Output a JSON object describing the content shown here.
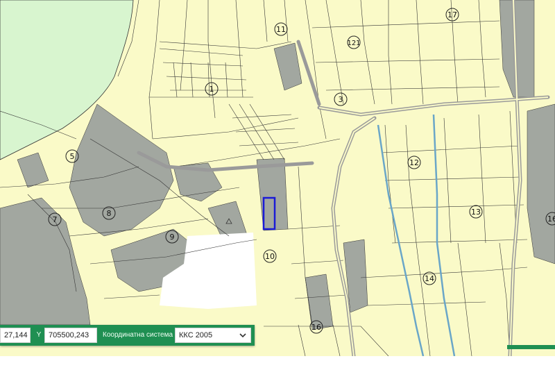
{
  "toolbar": {
    "x_value": "27,144",
    "y_label": "Y",
    "y_value": "705500,243",
    "crs_label": "Координатна система",
    "crs_value": "ККС 2005"
  },
  "map": {
    "colors": {
      "parcel": "#fafac8",
      "forest": "#d8f5cf",
      "built": "#9ea49c",
      "road": "#a9a9a9",
      "line": "#333333",
      "selected": "#1a1ad6"
    },
    "district_labels": [
      "11",
      "17",
      "121",
      "1",
      "3",
      "5",
      "12",
      "8",
      "7",
      "9",
      "13",
      "10",
      "14",
      "16",
      "16"
    ]
  }
}
